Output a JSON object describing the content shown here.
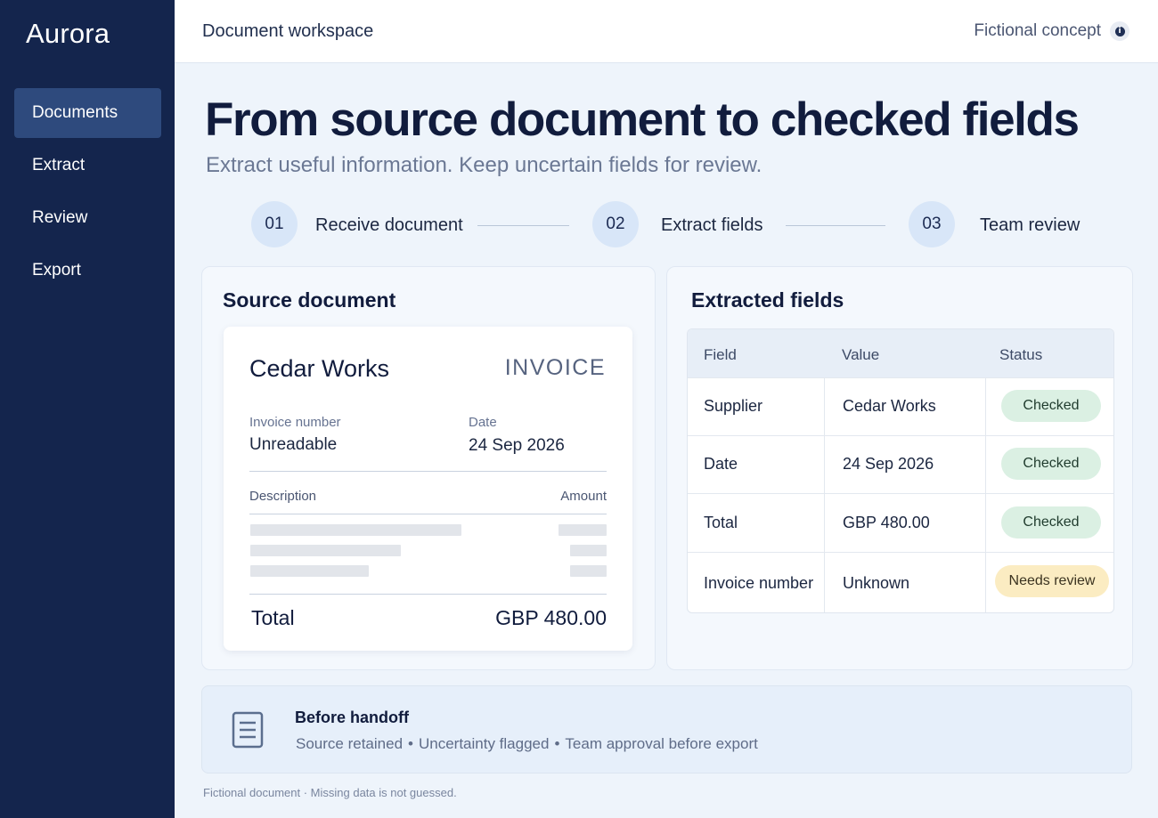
{
  "app": {
    "brand": "Aurora"
  },
  "sidebar": {
    "items": [
      {
        "label": "Documents",
        "active": true
      },
      {
        "label": "Extract",
        "active": false
      },
      {
        "label": "Review",
        "active": false
      },
      {
        "label": "Export",
        "active": false
      }
    ]
  },
  "topbar": {
    "title": "Document workspace",
    "right_label": "Fictional concept",
    "info_icon": "info-icon"
  },
  "hero": {
    "title": "From source document to checked fields",
    "subtitle": "Extract useful information. Keep uncertain fields for review."
  },
  "steps": [
    {
      "number": "01",
      "label": "Receive document"
    },
    {
      "number": "02",
      "label": "Extract fields"
    },
    {
      "number": "03",
      "label": "Team review"
    }
  ],
  "source_panel": {
    "title": "Source document",
    "invoice": {
      "company": "Cedar Works",
      "badge": "INVOICE",
      "number_label": "Invoice number",
      "number_value": "Unreadable",
      "date_label": "Date",
      "date_value": "24 Sep 2026",
      "description_header": "Description",
      "amount_header": "Amount",
      "total_label": "Total",
      "total_value": "GBP 480.00"
    }
  },
  "fields_panel": {
    "title": "Extracted fields",
    "columns": [
      "Field",
      "Value",
      "Status"
    ],
    "rows": [
      {
        "field": "Supplier",
        "value": "Cedar Works",
        "status": "Checked"
      },
      {
        "field": "Date",
        "value": "24 Sep 2026",
        "status": "Checked"
      },
      {
        "field": "Total",
        "value": "GBP 480.00",
        "status": "Checked"
      },
      {
        "field": "Invoice number",
        "value": "Unknown",
        "status": "Needs review"
      }
    ]
  },
  "handoff": {
    "title": "Before handoff",
    "items": [
      "Source retained",
      "Uncertainty flagged",
      "Team approval before export"
    ],
    "separator": "•",
    "icon": "document-icon"
  },
  "footnote": "Fictional document · Missing data is not guessed.",
  "colors": {
    "sidebar": "#14254d",
    "active_nav": "#2e4a7d",
    "checked_pill": "#dbf0e3",
    "review_pill": "#fbecc2"
  }
}
